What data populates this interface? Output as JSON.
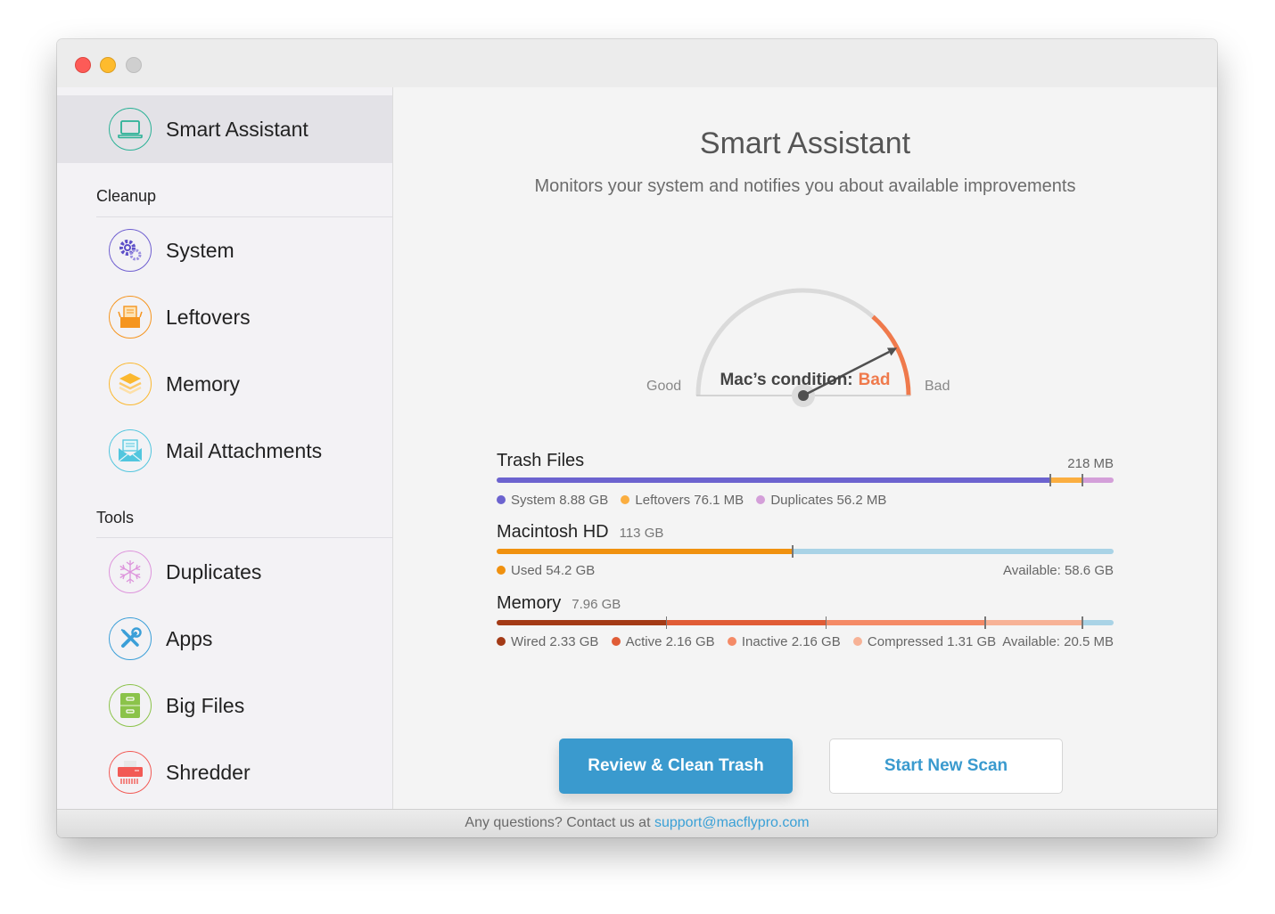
{
  "window": {
    "controls": [
      "close",
      "minimize",
      "maximize"
    ]
  },
  "sidebar": {
    "active_item": {
      "label": "Smart Assistant",
      "icon": "laptop-icon",
      "color": "#2bb196"
    },
    "sections": [
      {
        "title": "Cleanup",
        "items": [
          {
            "label": "System",
            "icon": "gears-icon",
            "color": "#6f5fd0"
          },
          {
            "label": "Leftovers",
            "icon": "box-icon",
            "color": "#f5951f"
          },
          {
            "label": "Memory",
            "icon": "layers-icon",
            "color": "#fbb82f"
          },
          {
            "label": "Mail Attachments",
            "icon": "envelope-icon",
            "color": "#52c6de"
          }
        ]
      },
      {
        "title": "Tools",
        "items": [
          {
            "label": "Duplicates",
            "icon": "snowflake-icon",
            "color": "#dd94dc"
          },
          {
            "label": "Apps",
            "icon": "tools-icon",
            "color": "#3b9fd8"
          },
          {
            "label": "Big Files",
            "icon": "cabinet-icon",
            "color": "#8bc34a"
          },
          {
            "label": "Shredder",
            "icon": "shredder-icon",
            "color": "#f25a55"
          }
        ]
      }
    ]
  },
  "main": {
    "title": "Smart Assistant",
    "subtitle": "Monitors your system and notifies you about available improvements",
    "gauge": {
      "left_label": "Good",
      "right_label": "Bad",
      "level": 0.85,
      "bad_zone_start": 0.73,
      "condition_label": "Mac’s condition:",
      "condition_value": "Bad"
    },
    "trash": {
      "title": "Trash Files",
      "total": "218 MB",
      "segments": [
        {
          "label": "System",
          "value": "8.88 GB",
          "share": 0.898,
          "color": "#6c63cf"
        },
        {
          "label": "Leftovers",
          "value": "76.1 MB",
          "share": 0.052,
          "color": "#fbae40"
        },
        {
          "label": "Duplicates",
          "value": "56.2 MB",
          "share": 0.05,
          "color": "#d49fd9"
        }
      ]
    },
    "disk": {
      "title": "Macintosh HD",
      "total": "113 GB",
      "segments": [
        {
          "label": "Used",
          "value": "54.2 GB",
          "share": 0.48,
          "color": "#f0910f"
        },
        {
          "label": "Available",
          "value": "58.6 GB",
          "share": 0.52,
          "color": "#a9d3e6"
        }
      ],
      "available_text": "Available: 58.6 GB"
    },
    "memory": {
      "title": "Memory",
      "total": "7.96 GB",
      "segments": [
        {
          "label": "Wired",
          "value": "2.33 GB",
          "share": 0.276,
          "color": "#a33a16"
        },
        {
          "label": "Active",
          "value": "2.16 GB",
          "share": 0.258,
          "color": "#e05c36"
        },
        {
          "label": "Inactive",
          "value": "2.16 GB",
          "share": 0.258,
          "color": "#f48a66"
        },
        {
          "label": "Compressed",
          "value": "1.31 GB",
          "share": 0.158,
          "color": "#f7b296"
        },
        {
          "label": "Available",
          "value": "20.5 MB",
          "share": 0.05,
          "color": "#a9d3e6"
        }
      ],
      "available_text": "Available: 20.5 MB"
    },
    "buttons": {
      "primary": "Review & Clean Trash",
      "secondary": "Start New Scan"
    }
  },
  "footer": {
    "text": "Any questions? Contact us at ",
    "link": "support@macflypro.com"
  }
}
